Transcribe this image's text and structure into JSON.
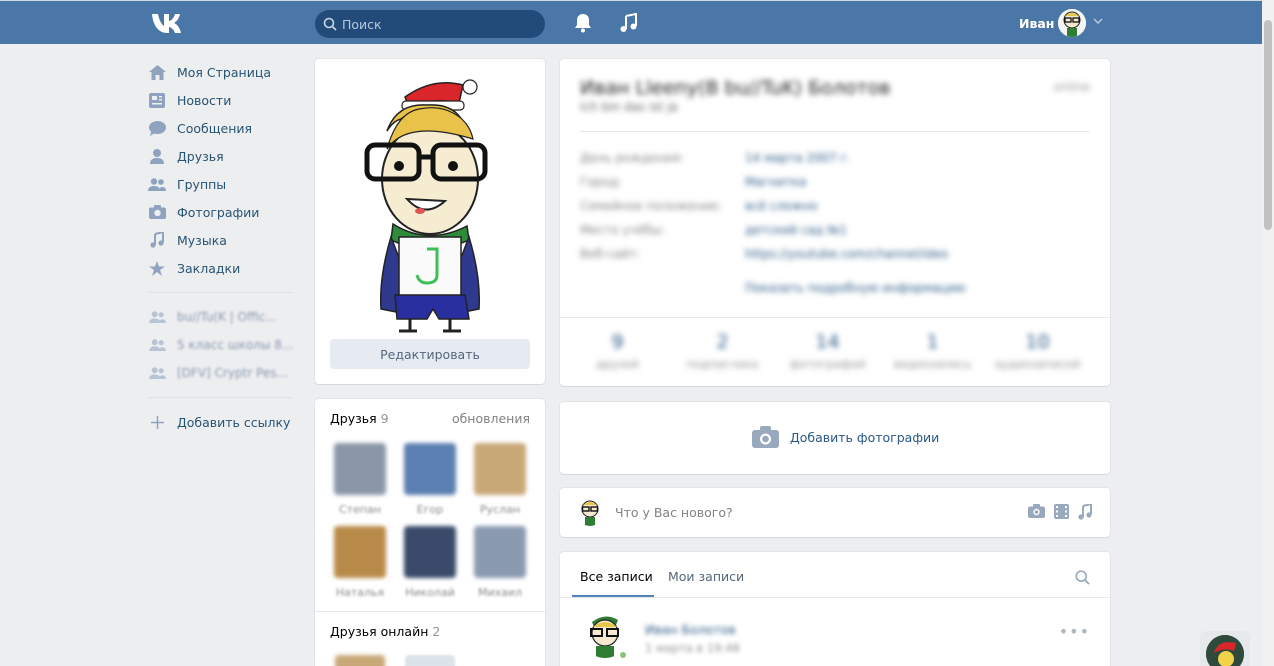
{
  "header": {
    "logo": "VK",
    "search_placeholder": "Поиск",
    "user_name": "Иван",
    "bg_color": "#4a76a8"
  },
  "nav": {
    "items": [
      {
        "label": "Моя Страница",
        "icon": "home-icon"
      },
      {
        "label": "Новости",
        "icon": "news-icon"
      },
      {
        "label": "Сообщения",
        "icon": "messages-icon"
      },
      {
        "label": "Друзья",
        "icon": "friend-icon"
      },
      {
        "label": "Группы",
        "icon": "groups-icon"
      },
      {
        "label": "Фотографии",
        "icon": "camera-icon"
      },
      {
        "label": "Музыка",
        "icon": "music-icon"
      },
      {
        "label": "Закладки",
        "icon": "star-icon"
      }
    ],
    "groups": [
      "bu//Tu(K | Offic...",
      "5 класс школы 8...",
      "[DFV] Cryptr Pes..."
    ],
    "add_link": "Добавить ссылку"
  },
  "avatar_card": {
    "edit_button": "Редактировать"
  },
  "friends": {
    "title": "Друзья",
    "count": "9",
    "updates": "обновления",
    "list": [
      {
        "name": "Степан",
        "color": "#8a97a8"
      },
      {
        "name": "Егор",
        "color": "#5b7fb0"
      },
      {
        "name": "Руслан",
        "color": "#c9a878"
      },
      {
        "name": "Наталья",
        "color": "#b88a4a"
      },
      {
        "name": "Николай",
        "color": "#3a4a6a"
      },
      {
        "name": "Михаил",
        "color": "#8a9ab0"
      }
    ],
    "online_title": "Друзья онлайн",
    "online_count": "2"
  },
  "profile": {
    "name": "Иван Lleeny(B bu//TuK) Болотов",
    "status": "Ich bin das ist ja",
    "online": "online",
    "rows": [
      {
        "key": "День рождения:",
        "value": "14 марта 2007 г."
      },
      {
        "key": "Город:",
        "value": "Магнитка"
      },
      {
        "key": "Семейное положение:",
        "value": "всё сложно"
      },
      {
        "key": "Место учёбы:",
        "value": "детский сад №1"
      },
      {
        "key": "Веб-сайт:",
        "value": "https://youtube.com/channel/ideo"
      }
    ],
    "more": "Показать подробную информацию",
    "stats": [
      {
        "n": "9",
        "l": "друзей"
      },
      {
        "n": "2",
        "l": "подписчика"
      },
      {
        "n": "14",
        "l": "фотографий"
      },
      {
        "n": "1",
        "l": "видеозапись"
      },
      {
        "n": "10",
        "l": "аудиозаписей"
      }
    ]
  },
  "add_photos": "Добавить фотографии",
  "post": {
    "placeholder": "Что у Вас нового?"
  },
  "wall": {
    "tab_all": "Все записи",
    "tab_mine": "Мои записи",
    "author": "Иван Болотов",
    "date": "1 марта в 19:48",
    "more": "•••"
  }
}
